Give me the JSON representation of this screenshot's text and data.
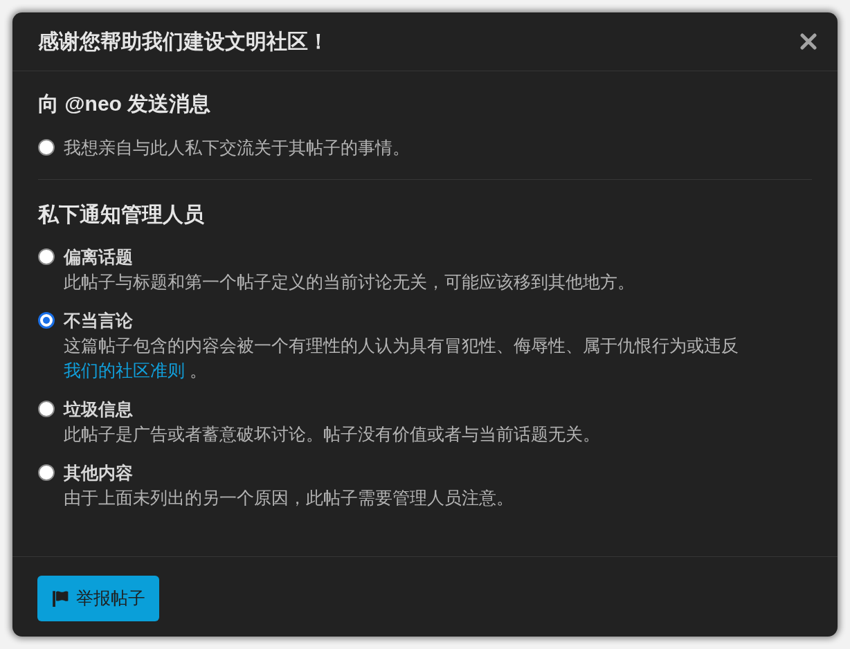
{
  "dialog": {
    "title": "感谢您帮助我们建设文明社区！",
    "sections": [
      {
        "heading": "向 @neo 发送消息",
        "options": [
          {
            "description": "我想亲自与此人私下交流关于其帖子的事情。",
            "selected": false
          }
        ]
      },
      {
        "heading": "私下通知管理人员",
        "options": [
          {
            "title": "偏离话题",
            "description": "此帖子与标题和第一个帖子定义的当前讨论无关，可能应该移到其他地方。",
            "selected": false
          },
          {
            "title": "不当言论",
            "description": "这篇帖子包含的内容会被一个有理性的人认为具有冒犯性、侮辱性、属于仇恨行为或违反",
            "link": "我们的社区准则",
            "after_link": "。",
            "selected": true
          },
          {
            "title": "垃圾信息",
            "description": "此帖子是广告或者蓄意破坏讨论。帖子没有价值或者与当前话题无关。",
            "selected": false
          },
          {
            "title": "其他内容",
            "description": "由于上面未列出的另一个原因，此帖子需要管理人员注意。",
            "selected": false
          }
        ]
      }
    ],
    "button": {
      "label": "举报帖子"
    }
  }
}
